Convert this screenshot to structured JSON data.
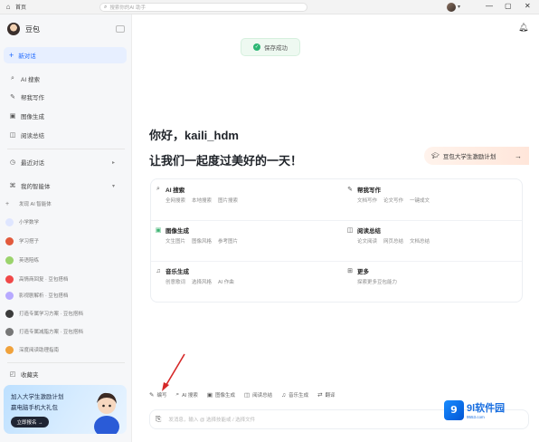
{
  "titlebar": {
    "tab_label": "首页",
    "search_placeholder": "搜索你的AI 助手",
    "window_controls": [
      "—",
      "▢",
      "✕"
    ]
  },
  "sidebar": {
    "app_name": "豆包",
    "new_chat": "新对话",
    "nav": [
      {
        "icon": "search-icon",
        "label": "AI 搜索"
      },
      {
        "icon": "pen-icon",
        "label": "帮我写作"
      },
      {
        "icon": "image-icon",
        "label": "图像生成"
      },
      {
        "icon": "book-icon",
        "label": "阅读总结"
      }
    ],
    "recent_label": "最近对话",
    "agents_label": "我的智能体",
    "agents": [
      {
        "label": "发现 AI 智能体",
        "color": "#e8e8e8"
      },
      {
        "label": "小学数学",
        "color": "#dfe6ff"
      },
      {
        "label": "学习搭子",
        "color": "#e25a3c"
      },
      {
        "label": "英语陪练",
        "color": "#9bd36c"
      },
      {
        "label": "高情商回复 · 豆包搭档",
        "color": "#f04848"
      },
      {
        "label": "影视剧解析 · 豆包搭档",
        "color": "#b7a9ff"
      },
      {
        "label": "打造专属学习方案 · 豆包搭档",
        "color": "#3c3c3c"
      },
      {
        "label": "打造专属减脂方案 · 豆包搭档",
        "color": "#777777"
      },
      {
        "label": "深度阅读助理指南",
        "color": "#f0a23c"
      }
    ],
    "favorites_label": "收藏夹",
    "banner": {
      "line1": "加入大学生激励计划",
      "line2": "赢电脑手机大礼包",
      "button": "立即报名 →"
    }
  },
  "main": {
    "toast": "保存成功",
    "greeting_line1": "你好，kaili_hdm",
    "greeting_line2": "让我们一起度过美好的一天！",
    "promo": "豆包大学生激励计划",
    "cards": [
      {
        "icon": "search-icon",
        "title": "AI 搜索",
        "subs": [
          "全网搜索",
          "本地搜索",
          "图片搜索"
        ]
      },
      {
        "icon": "pen-icon",
        "title": "帮我写作",
        "subs": [
          "文档写作",
          "论文写作",
          "一键成文"
        ]
      },
      {
        "icon": "image-icon",
        "title": "图像生成",
        "subs": [
          "文生图片",
          "图像风格",
          "参考图片"
        ]
      },
      {
        "icon": "book-icon",
        "title": "阅读总结",
        "subs": [
          "论文阅读",
          "网页总结",
          "文档总结"
        ]
      },
      {
        "icon": "music-icon",
        "title": "音乐生成",
        "subs": [
          "创意歌词",
          "选择风格",
          "AI 作曲"
        ]
      },
      {
        "icon": "grid-icon",
        "title": "更多",
        "subs": [
          "探索更多豆包能力"
        ]
      }
    ],
    "toolbar": [
      {
        "icon": "pen-icon",
        "label": "编写"
      },
      {
        "icon": "search-icon",
        "label": "AI 搜索"
      },
      {
        "icon": "image-icon",
        "label": "图像生成"
      },
      {
        "icon": "book-icon",
        "label": "阅读总结"
      },
      {
        "icon": "music-icon",
        "label": "音乐生成"
      },
      {
        "icon": "translate-icon",
        "label": "翻译"
      }
    ],
    "input_placeholder": "发消息，输入 @ 选择技能或 / 选择文件"
  },
  "watermark": {
    "title": "9l软件园",
    "sub": "9553.com"
  }
}
